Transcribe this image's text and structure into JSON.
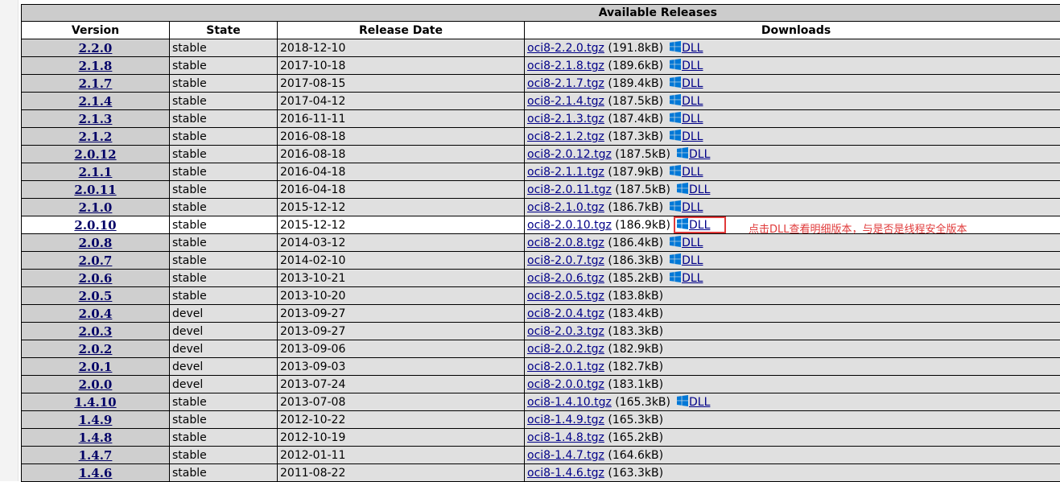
{
  "table": {
    "caption": "Available Releases",
    "columns": [
      "Version",
      "State",
      "Release Date",
      "Downloads"
    ],
    "rows": [
      {
        "version": "2.2.0",
        "state": "stable",
        "date": "2018-12-10",
        "file": "oci8-2.2.0.tgz",
        "size": "(191.8kB)",
        "dll": "DLL"
      },
      {
        "version": "2.1.8",
        "state": "stable",
        "date": "2017-10-18",
        "file": "oci8-2.1.8.tgz",
        "size": "(189.6kB)",
        "dll": "DLL"
      },
      {
        "version": "2.1.7",
        "state": "stable",
        "date": "2017-08-15",
        "file": "oci8-2.1.7.tgz",
        "size": "(189.4kB)",
        "dll": "DLL"
      },
      {
        "version": "2.1.4",
        "state": "stable",
        "date": "2017-04-12",
        "file": "oci8-2.1.4.tgz",
        "size": "(187.5kB)",
        "dll": "DLL"
      },
      {
        "version": "2.1.3",
        "state": "stable",
        "date": "2016-11-11",
        "file": "oci8-2.1.3.tgz",
        "size": "(187.4kB)",
        "dll": "DLL"
      },
      {
        "version": "2.1.2",
        "state": "stable",
        "date": "2016-08-18",
        "file": "oci8-2.1.2.tgz",
        "size": "(187.3kB)",
        "dll": "DLL"
      },
      {
        "version": "2.0.12",
        "state": "stable",
        "date": "2016-08-18",
        "file": "oci8-2.0.12.tgz",
        "size": "(187.5kB)",
        "dll": "DLL"
      },
      {
        "version": "2.1.1",
        "state": "stable",
        "date": "2016-04-18",
        "file": "oci8-2.1.1.tgz",
        "size": "(187.9kB)",
        "dll": "DLL"
      },
      {
        "version": "2.0.11",
        "state": "stable",
        "date": "2016-04-18",
        "file": "oci8-2.0.11.tgz",
        "size": "(187.5kB)",
        "dll": "DLL"
      },
      {
        "version": "2.1.0",
        "state": "stable",
        "date": "2015-12-12",
        "file": "oci8-2.1.0.tgz",
        "size": "(186.7kB)",
        "dll": "DLL"
      },
      {
        "version": "2.0.10",
        "state": "stable",
        "date": "2015-12-12",
        "file": "oci8-2.0.10.tgz",
        "size": "(186.9kB)",
        "dll": "DLL",
        "highlight": true
      },
      {
        "version": "2.0.8",
        "state": "stable",
        "date": "2014-03-12",
        "file": "oci8-2.0.8.tgz",
        "size": "(186.4kB)",
        "dll": "DLL"
      },
      {
        "version": "2.0.7",
        "state": "stable",
        "date": "2014-02-10",
        "file": "oci8-2.0.7.tgz",
        "size": "(186.3kB)",
        "dll": "DLL"
      },
      {
        "version": "2.0.6",
        "state": "stable",
        "date": "2013-10-21",
        "file": "oci8-2.0.6.tgz",
        "size": "(185.2kB)",
        "dll": "DLL"
      },
      {
        "version": "2.0.5",
        "state": "stable",
        "date": "2013-10-20",
        "file": "oci8-2.0.5.tgz",
        "size": "(183.8kB)"
      },
      {
        "version": "2.0.4",
        "state": "devel",
        "date": "2013-09-27",
        "file": "oci8-2.0.4.tgz",
        "size": "(183.4kB)"
      },
      {
        "version": "2.0.3",
        "state": "devel",
        "date": "2013-09-27",
        "file": "oci8-2.0.3.tgz",
        "size": "(183.3kB)"
      },
      {
        "version": "2.0.2",
        "state": "devel",
        "date": "2013-09-06",
        "file": "oci8-2.0.2.tgz",
        "size": "(182.9kB)"
      },
      {
        "version": "2.0.1",
        "state": "devel",
        "date": "2013-09-03",
        "file": "oci8-2.0.1.tgz",
        "size": "(182.7kB)"
      },
      {
        "version": "2.0.0",
        "state": "devel",
        "date": "2013-07-24",
        "file": "oci8-2.0.0.tgz",
        "size": "(183.1kB)"
      },
      {
        "version": "1.4.10",
        "state": "stable",
        "date": "2013-07-08",
        "file": "oci8-1.4.10.tgz",
        "size": "(165.3kB)",
        "dll": "DLL"
      },
      {
        "version": "1.4.9",
        "state": "stable",
        "date": "2012-10-22",
        "file": "oci8-1.4.9.tgz",
        "size": "(165.3kB)"
      },
      {
        "version": "1.4.8",
        "state": "stable",
        "date": "2012-10-19",
        "file": "oci8-1.4.8.tgz",
        "size": "(165.2kB)"
      },
      {
        "version": "1.4.7",
        "state": "stable",
        "date": "2012-01-11",
        "file": "oci8-1.4.7.tgz",
        "size": "(164.6kB)"
      },
      {
        "version": "1.4.6",
        "state": "stable",
        "date": "2011-08-22",
        "file": "oci8-1.4.6.tgz",
        "size": "(163.3kB)"
      }
    ]
  },
  "annotation": "点击DLL查看明细版本，与是否是线程安全版本",
  "icons": {
    "dll": "windows-icon"
  },
  "colors": {
    "link": "#000088",
    "annotation": "#e03a3a",
    "header_bg": "#cccccc",
    "row_bg": "#e0e0e0",
    "version_bg": "#cfcfcf",
    "windows_blue": "#0078d7"
  }
}
